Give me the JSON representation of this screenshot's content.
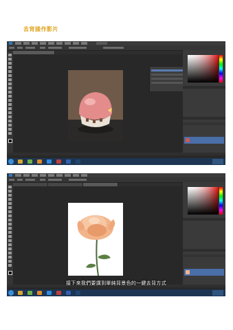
{
  "document": {
    "title": "去背操作影片"
  },
  "screenshot_two": {
    "caption": "接下來我們要講到單純背景色的一鍵去背方式"
  },
  "colors": {
    "title": "#e0a31c",
    "app_background": "#282828",
    "layer_selected": "#4a6ea8",
    "taskbar": "#1d3552"
  },
  "icons": [
    "windows-start-icon",
    "taskbar-app-icon",
    "photoshop-icon"
  ]
}
